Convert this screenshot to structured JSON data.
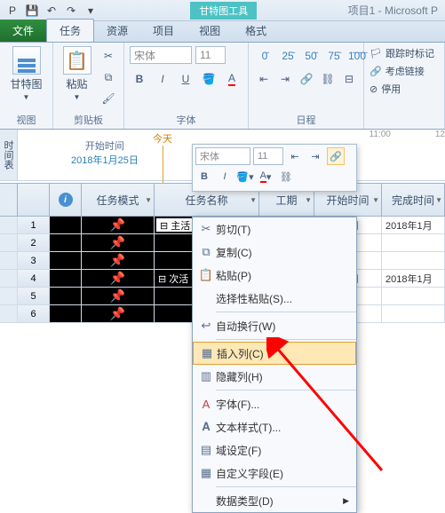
{
  "title": {
    "contextual": "甘特图工具",
    "app": "项目1 - Microsoft P"
  },
  "tabs": {
    "file": "文件",
    "t1": "任务",
    "t2": "资源",
    "t3": "项目",
    "t4": "视图",
    "t5": "格式"
  },
  "ribbon": {
    "view": {
      "gantt": "甘特图",
      "label": "视图"
    },
    "clip": {
      "paste": "粘贴",
      "label": "剪贴板"
    },
    "font": {
      "name": "宋体",
      "size": "11",
      "label": "字体"
    },
    "sched": {
      "label": "日程"
    },
    "links": {
      "track": "跟踪时标记",
      "respect": "考虑链接",
      "disable": "停用"
    }
  },
  "timeline": {
    "side": "时间表",
    "start_lbl": "开始时间",
    "start_date": "2018年1月25日",
    "today": "今天",
    "tick1": "11:00",
    "tick2": "12"
  },
  "mini": {
    "font": "宋体",
    "size": "11"
  },
  "grid": {
    "h_info": "ⓘ",
    "h_mode": "任务模式",
    "h_name": "任务名称",
    "h_work": "工期",
    "h_start": "开始时间",
    "h_end": "完成时间",
    "rows": [
      {
        "n": "1",
        "name": "⊟ 主活",
        "start": "018年1月",
        "end": "2018年1月"
      },
      {
        "n": "2",
        "name": "",
        "start": "",
        "end": ""
      },
      {
        "n": "3",
        "name": "",
        "start": "",
        "end": ""
      },
      {
        "n": "4",
        "name": "⊟ 次活",
        "start": "018年1月",
        "end": "2018年1月"
      },
      {
        "n": "5",
        "name": "",
        "start": "",
        "end": ""
      },
      {
        "n": "6",
        "name": "",
        "start": "",
        "end": ""
      }
    ]
  },
  "ctx": {
    "cut": "剪切(T)",
    "copy": "复制(C)",
    "paste": "粘贴(P)",
    "paste_special": "选择性粘贴(S)...",
    "wrap": "自动换行(W)",
    "insert_col": "插入列(C)",
    "hide_col": "隐藏列(H)",
    "font": "字体(F)...",
    "text_style": "文本样式(T)...",
    "field_set": "域设定(F)",
    "custom_field": "自定义字段(E)",
    "data_type": "数据类型(D)"
  }
}
